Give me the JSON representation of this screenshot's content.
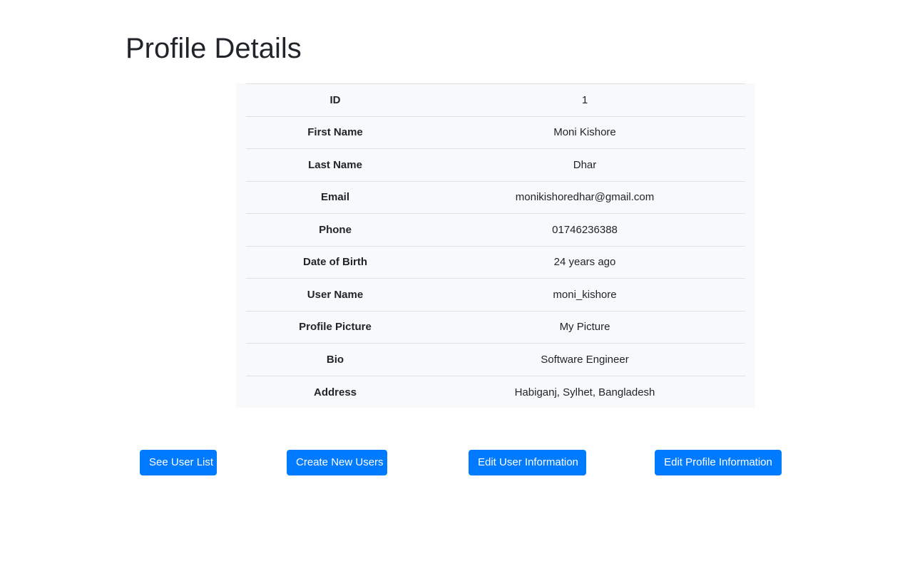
{
  "page": {
    "title": "Profile Details"
  },
  "profile": {
    "rows": [
      {
        "label": "ID",
        "value": "1"
      },
      {
        "label": "First Name",
        "value": "Moni Kishore"
      },
      {
        "label": "Last Name",
        "value": "Dhar"
      },
      {
        "label": "Email",
        "value": "monikishoredhar@gmail.com"
      },
      {
        "label": "Phone",
        "value": "01746236388"
      },
      {
        "label": "Date of Birth",
        "value": "24 years ago"
      },
      {
        "label": "User Name",
        "value": "moni_kishore"
      },
      {
        "label": "Profile Picture",
        "value": "My Picture"
      },
      {
        "label": "Bio",
        "value": "Software Engineer"
      },
      {
        "label": "Address",
        "value": "Habiganj, Sylhet, Bangladesh"
      }
    ]
  },
  "actions": {
    "see_user_list": "See User List",
    "create_new_users": "Create New Users",
    "edit_user_information": "Edit User Information",
    "edit_profile_information": "Edit Profile Information"
  },
  "colors": {
    "primary_button": "#007bff",
    "card_background": "#f8f9fa",
    "text": "#212529",
    "row_border": "#dee2e6"
  }
}
